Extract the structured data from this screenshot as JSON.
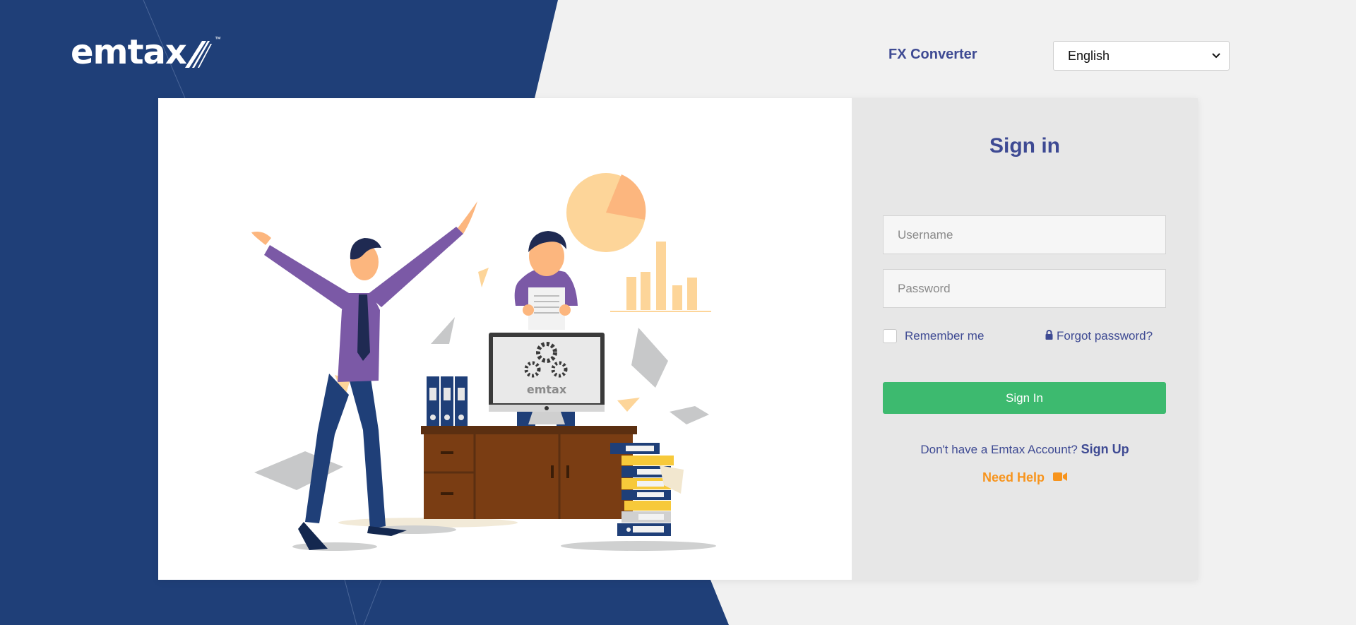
{
  "header": {
    "logo_text": "emtax",
    "logo_tm": "™",
    "fx_converter_label": "FX Converter",
    "language": {
      "selected": "English",
      "chevron_icon": "chevron-down-icon"
    }
  },
  "illustration": {
    "monitor_logo_text": "emtax"
  },
  "signin_form": {
    "title": "Sign in",
    "username_placeholder": "Username",
    "password_placeholder": "Password",
    "remember_label": "Remember me",
    "forgot_label": "Forgot password?",
    "forgot_icon": "lock-icon",
    "submit_label": "Sign In",
    "signup_prompt": "Don't have a Emtax Account?",
    "signup_label": "Sign Up",
    "help_label": "Need Help",
    "help_icon": "video-camera-icon"
  },
  "colors": {
    "brand_navy": "#1f3f78",
    "accent_blue": "#3e4a93",
    "button_green": "#3dba6f",
    "help_orange": "#f7941d",
    "page_gray": "#f1f1f1",
    "form_gray": "#e7e7e7"
  }
}
